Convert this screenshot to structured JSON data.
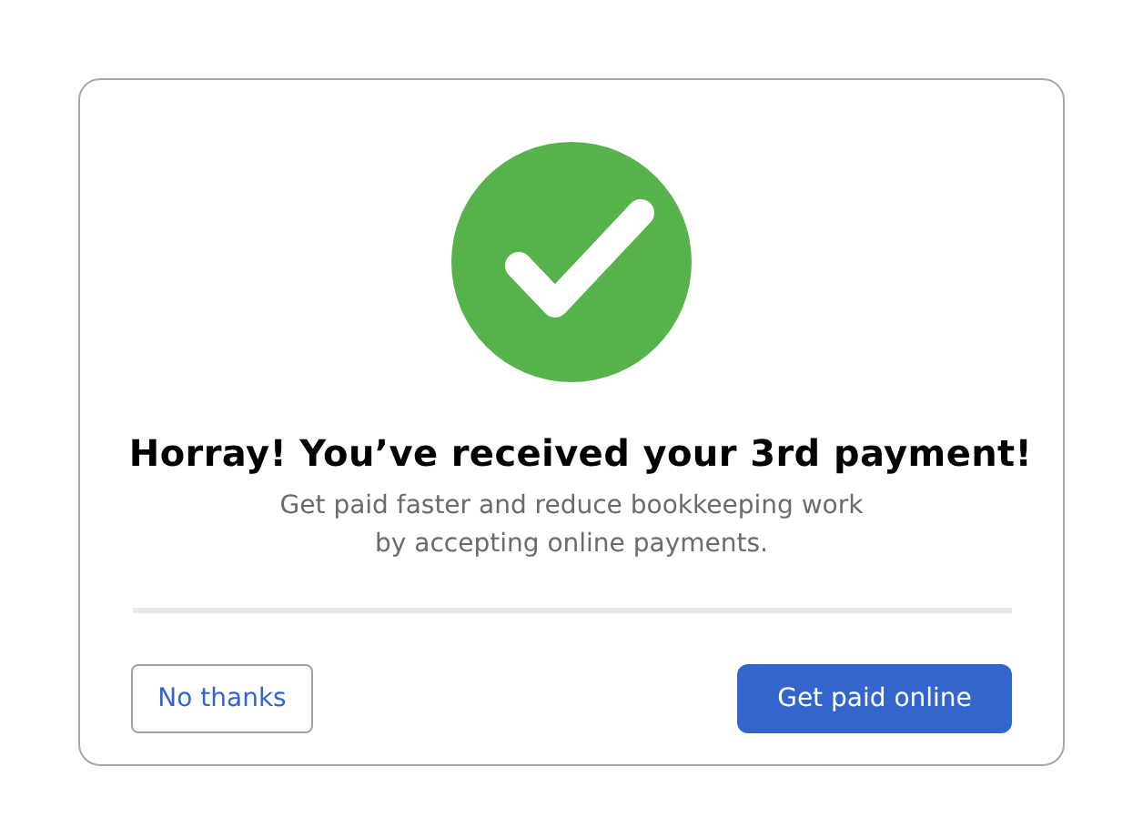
{
  "dialog": {
    "title": "Horray! You’ve received your 3rd payment!",
    "message": "Get paid faster and reduce bookkeeping work\nby accepting online payments.",
    "buttons": [
      {
        "label": "No thanks",
        "kind": "secondary"
      },
      {
        "label": "Get paid online",
        "kind": "primary"
      }
    ]
  }
}
